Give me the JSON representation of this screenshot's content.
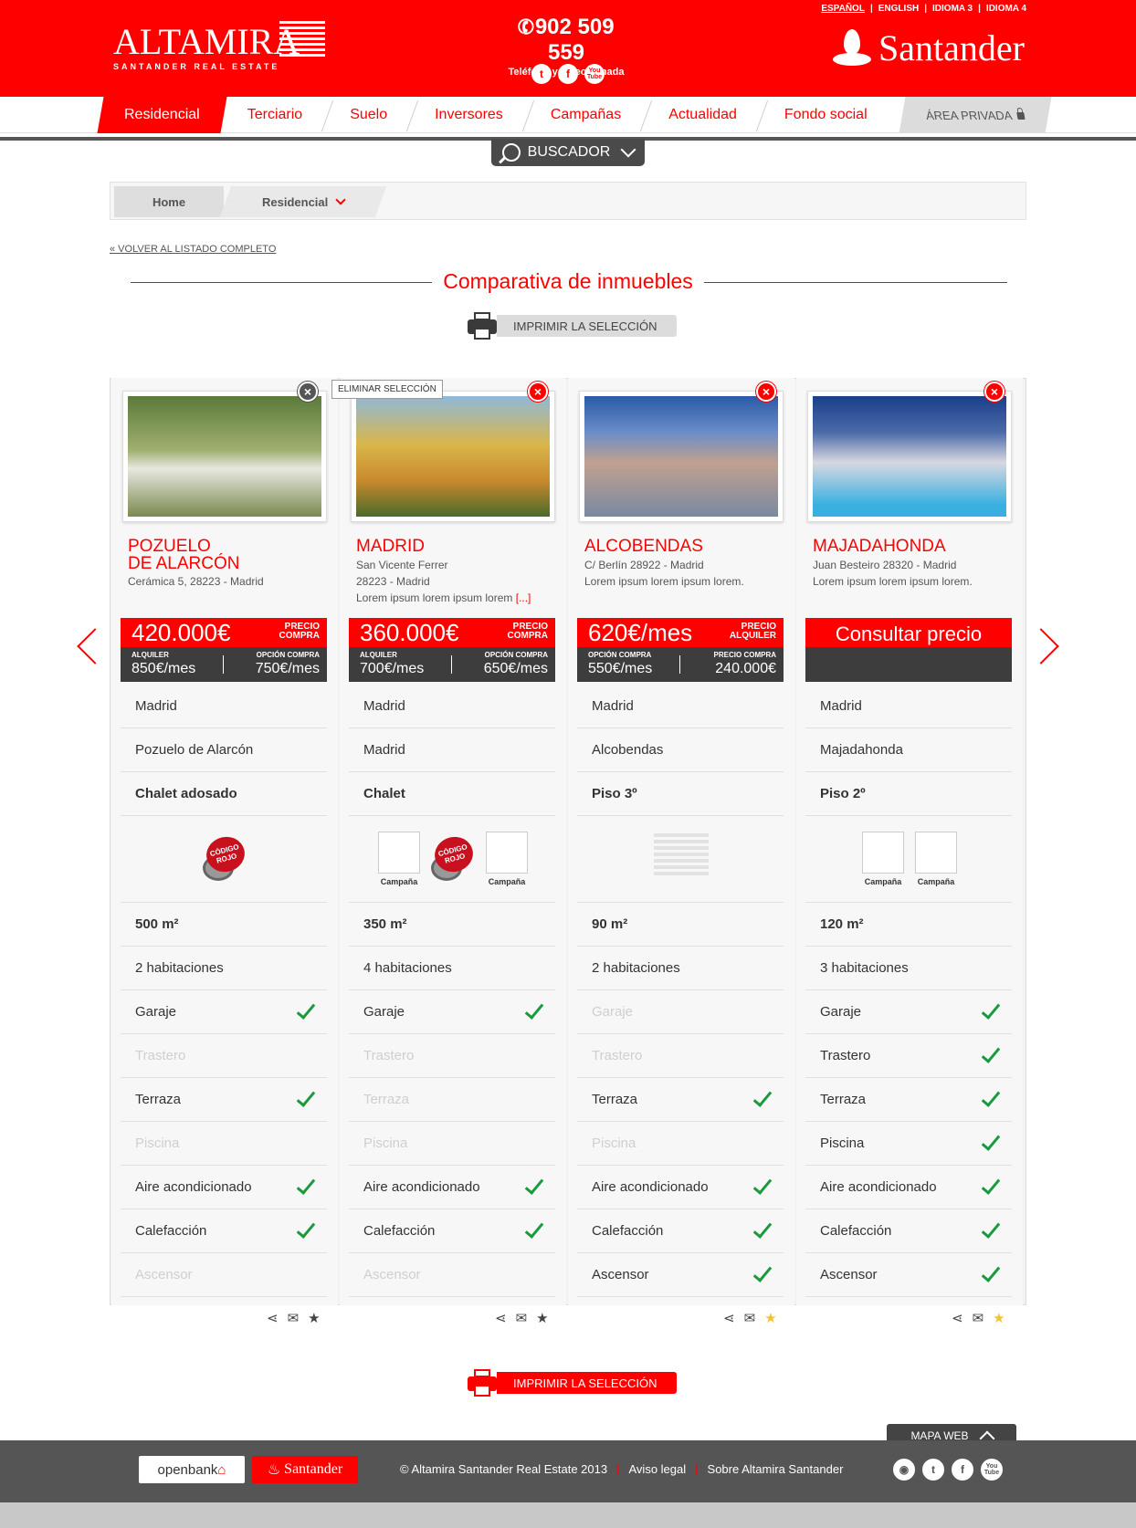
{
  "header": {
    "brand": "ALTAMIRA",
    "brand_sub": "SANTANDER REAL ESTATE",
    "phone": "902 509 559",
    "phone_sub": "Teléfono y videollamada",
    "partner": "Santander",
    "languages": [
      "ESPAÑOL",
      "ENGLISH",
      "IDIOMA 3",
      "IDIOMA 4"
    ],
    "social": [
      "t",
      "f",
      "You Tube"
    ]
  },
  "nav": {
    "items": [
      "Residencial",
      "Terciario",
      "Suelo",
      "Inversores",
      "Campañas",
      "Actualidad",
      "Fondo social"
    ],
    "private": "ÁREA PRIVADA"
  },
  "search": {
    "label": "BUSCADOR"
  },
  "breadcrumb": {
    "home": "Home",
    "current": "Residencial"
  },
  "back_link": "« VOLVER AL LISTADO COMPLETO",
  "page_title": "Comparativa de inmuebles",
  "print_label": "IMPRIMIR LA SELECCIÓN",
  "tooltip": "ELIMINAR SELECCIÓN",
  "campaign_label": "Campaña",
  "badge_text": "CÓDIGO ROJO",
  "properties": [
    {
      "city_line1": "POZUELO",
      "city_line2": "DE ALARCÓN",
      "addr": [
        "Cerámica 5, 28223 - Madrid"
      ],
      "price": "420.000€",
      "price_tag": [
        "PRECIO",
        "COMPRA"
      ],
      "sub_left_k": "ALQUILER",
      "sub_left_v": "850€/mes",
      "sub_right_k": "OPCIÓN COMPRA",
      "sub_right_v": "750€/mes",
      "province": "Madrid",
      "town": "Pozuelo de Alarcón",
      "type": "Chalet adosado",
      "area": "500 m²",
      "rooms": "2 habitaciones",
      "features": {
        "Garaje": true,
        "Trastero": false,
        "Terraza": true,
        "Piscina": false,
        "Aire acondicionado": true,
        "Calefacción": true,
        "Ascensor": false
      },
      "favorite": false
    },
    {
      "city_line1": "MADRID",
      "city_line2": "",
      "addr": [
        "San Vicente Ferrer",
        "28223 - Madrid",
        "Lorem ipsum lorem ipsum lorem "
      ],
      "addr_more": "[...]",
      "price": "360.000€",
      "price_tag": [
        "PRECIO",
        "COMPRA"
      ],
      "sub_left_k": "ALQUILER",
      "sub_left_v": "700€/mes",
      "sub_right_k": "OPCIÓN COMPRA",
      "sub_right_v": "650€/mes",
      "province": "Madrid",
      "town": "Madrid",
      "type": "Chalet",
      "area": "350 m²",
      "rooms": "4 habitaciones",
      "features": {
        "Garaje": true,
        "Trastero": false,
        "Terraza": false,
        "Piscina": false,
        "Aire acondicionado": true,
        "Calefacción": true,
        "Ascensor": false
      },
      "favorite": false
    },
    {
      "city_line1": "ALCOBENDAS",
      "city_line2": "",
      "addr": [
        "C/ Berlín 28922 - Madrid",
        "Lorem ipsum lorem ipsum lorem."
      ],
      "price": "620€/mes",
      "price_tag": [
        "PRECIO",
        "ALQUILER"
      ],
      "sub_left_k": "OPCIÓN COMPRA",
      "sub_left_v": "550€/mes",
      "sub_right_k": "PRECIO COMPRA",
      "sub_right_v": "240.000€",
      "province": "Madrid",
      "town": "Alcobendas",
      "type": "Piso 3º",
      "area": "90 m²",
      "rooms": "2 habitaciones",
      "features": {
        "Garaje": false,
        "Trastero": false,
        "Terraza": true,
        "Piscina": false,
        "Aire acondicionado": true,
        "Calefacción": true,
        "Ascensor": true
      },
      "favorite": true
    },
    {
      "city_line1": "MAJADAHONDA",
      "city_line2": "",
      "addr": [
        "Juan Besteiro 28320 - Madrid",
        "Lorem ipsum lorem ipsum lorem."
      ],
      "price": "Consultar precio",
      "province": "Madrid",
      "town": "Majadahonda",
      "type": "Piso 2º",
      "area": "120 m²",
      "rooms": "3 habitaciones",
      "features": {
        "Garaje": true,
        "Trastero": true,
        "Terraza": true,
        "Piscina": true,
        "Aire acondicionado": true,
        "Calefacción": true,
        "Ascensor": true
      },
      "favorite": true
    }
  ],
  "footer": {
    "mapa_web": "MAPA WEB",
    "openbank": "openbank",
    "santander": "Santander",
    "copyright": "© Altamira Santander Real Estate 2013",
    "links": [
      "Aviso legal",
      "Sobre Altamira Santander"
    ],
    "social": [
      "rss",
      "t",
      "f",
      "You Tube"
    ]
  },
  "colors": {
    "brand_red": "#ff0000",
    "dark": "#3d3d3d",
    "check_green": "#1a9a3c",
    "star_gold": "#f1c232"
  }
}
